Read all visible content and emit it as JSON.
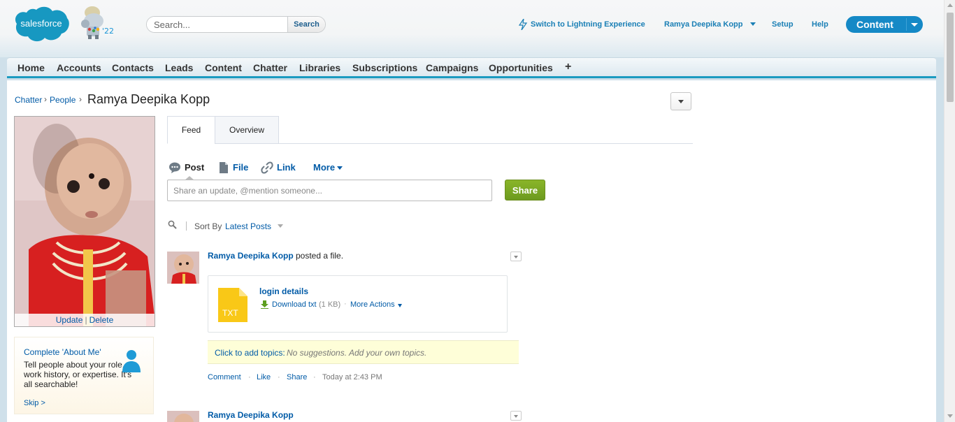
{
  "header": {
    "logo_text": "salesforce",
    "mascot_year": "'22",
    "search_placeholder": "Search...",
    "search_button": "Search",
    "lightning_link": "Switch to Lightning Experience",
    "user_name": "Ramya Deepika Kopp",
    "setup": "Setup",
    "help": "Help",
    "app_name": "Content"
  },
  "tabs": [
    "Home",
    "Accounts",
    "Contacts",
    "Leads",
    "Content",
    "Chatter",
    "Libraries",
    "Subscriptions",
    "Campaigns",
    "Opportunities",
    "+"
  ],
  "breadcrumb": {
    "chatter": "Chatter",
    "sep1": "›",
    "people": "People",
    "sep2": "›",
    "name": "Ramya Deepika Kopp"
  },
  "photo_actions": {
    "update": "Update",
    "sep": "|",
    "delete": "Delete"
  },
  "about_card": {
    "title": "Complete 'About Me'",
    "text": "Tell people about your role, work history, or expertise. It's all searchable!",
    "skip": "Skip >"
  },
  "subtabs": {
    "feed": "Feed",
    "overview": "Overview"
  },
  "publisher": {
    "post": "Post",
    "file": "File",
    "link": "Link",
    "more": "More",
    "placeholder": "Share an update, @mention someone...",
    "share": "Share"
  },
  "sort": {
    "label": "Sort By",
    "value": "Latest Posts"
  },
  "feed_items": [
    {
      "author": "Ramya Deepika Kopp",
      "action": "posted a file.",
      "file": {
        "type_label": "TXT",
        "name": "login details",
        "download": "Download txt",
        "size": "(1 KB)",
        "dot": "·",
        "more_actions": "More Actions"
      },
      "topics_link": "Click to add topics:",
      "topics_hint": "No suggestions. Add your own topics.",
      "footer": {
        "comment": "Comment",
        "like": "Like",
        "share": "Share",
        "dot": "·",
        "time": "Today at 2:43 PM"
      }
    },
    {
      "author": "Ramya Deepika Kopp"
    }
  ],
  "colors": {
    "link": "#015ba7",
    "tab_accent": "#1b9bc0",
    "app_button": "#1589c6",
    "share_green": "#7aa624",
    "topics_bg": "#fefed8",
    "file_icon": "#f9c817"
  }
}
